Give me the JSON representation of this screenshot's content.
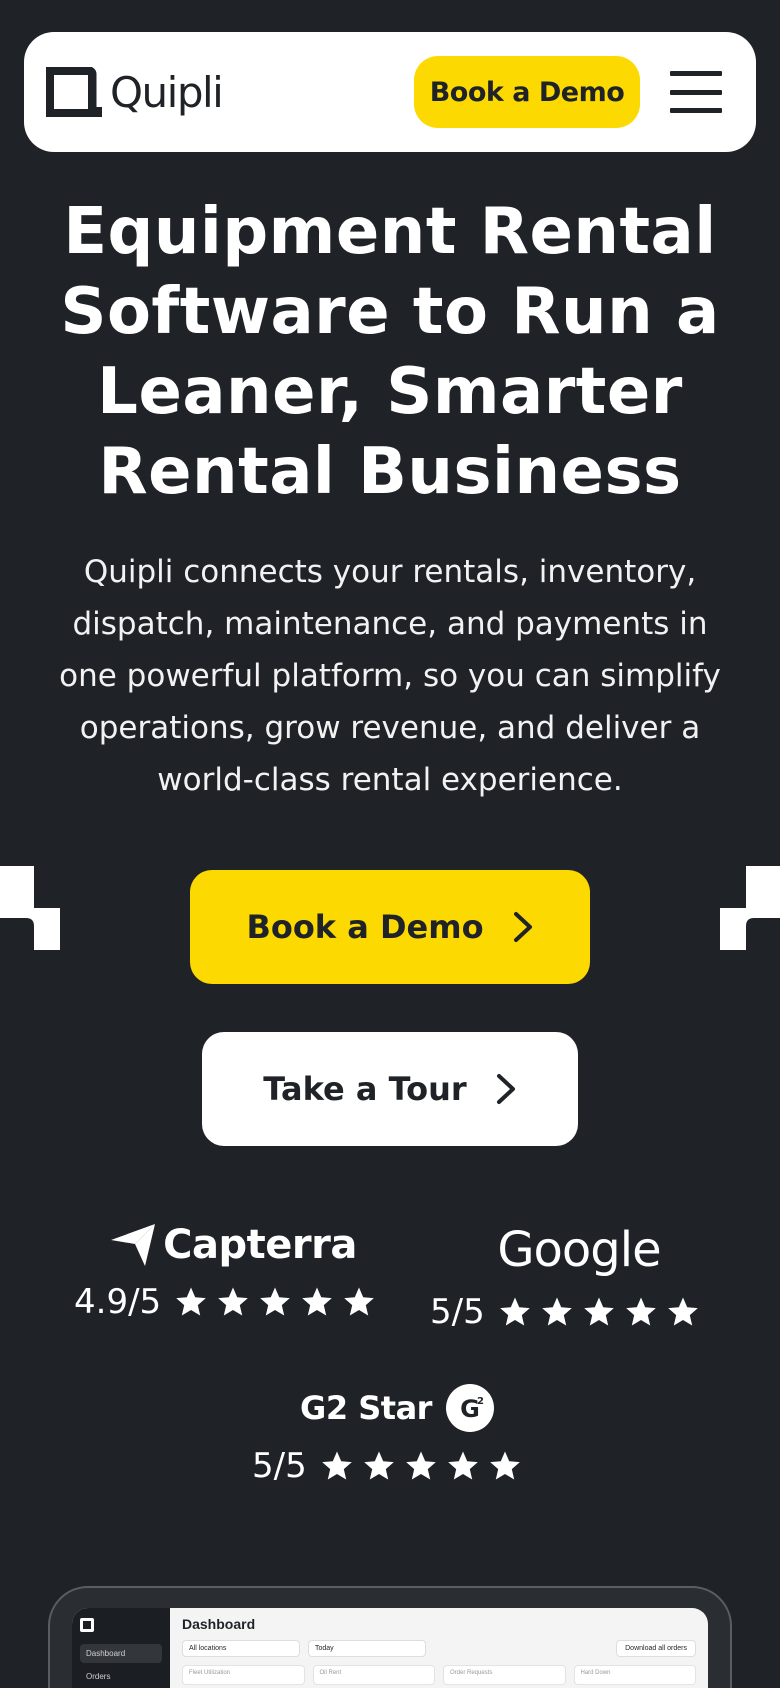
{
  "header": {
    "logo_text": "Quipli",
    "demo_button": "Book a Demo"
  },
  "hero": {
    "title": "Equipment Rental Software to Run a Leaner, Smarter Rental Business",
    "subtitle": "Quipli connects your rentals, inventory, dispatch, maintenance, and payments in one powerful platform, so you can simplify operations, grow revenue, and deliver a world-class rental experience.",
    "primary_cta": "Book a Demo",
    "secondary_cta": "Take a Tour"
  },
  "ratings": [
    {
      "brand": "Capterra",
      "score": "4.9/5",
      "stars": 5
    },
    {
      "brand": "Google",
      "score": "5/5",
      "stars": 5
    },
    {
      "brand": "G2 Star",
      "score": "5/5",
      "stars": 5
    }
  ],
  "dashboard": {
    "title": "Dashboard",
    "sidebar_items": [
      "Dashboard",
      "Orders"
    ],
    "filters": [
      "All locations",
      "Today"
    ],
    "download_button": "Download all orders",
    "cards": [
      "Fleet Utilization",
      "Oil Rent",
      "Order Requests",
      "Hard Down"
    ]
  },
  "colors": {
    "background": "#1f2328",
    "accent": "#fcd900",
    "surface": "#ffffff"
  }
}
